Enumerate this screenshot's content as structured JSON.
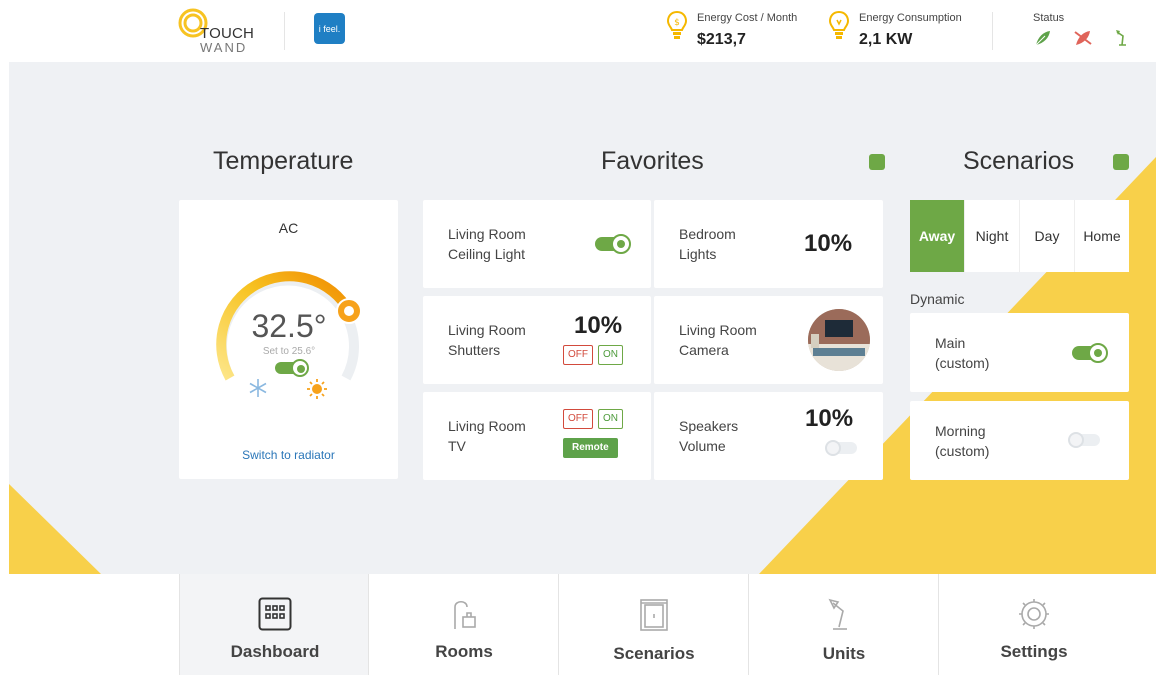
{
  "header": {
    "logo_line1": "TOUCH",
    "logo_line2": "WAND",
    "partner_logo": "i feel.",
    "energy_cost_label": "Energy Cost / Month",
    "energy_cost_value": "$213,7",
    "energy_consumption_label": "Energy Consumption",
    "energy_consumption_value": "2,1 KW",
    "status_label": "Status",
    "status_icons": [
      "leaf-icon",
      "leaf-crossed-icon",
      "lamp-icon"
    ]
  },
  "temperature": {
    "title": "Temperature",
    "mode": "AC",
    "value": "32.5°",
    "set_to": "Set to 25.6°",
    "switch_link": "Switch to radiator",
    "ac_on": true
  },
  "favorites": {
    "title": "Favorites",
    "items": [
      {
        "name_line1": "Living Room",
        "name_line2": "Ceiling Light",
        "control": "toggle",
        "on": true
      },
      {
        "name_line1": "Bedroom",
        "name_line2": "Lights",
        "value": "10%"
      },
      {
        "name_line1": "Living Room",
        "name_line2": "Shutters",
        "value": "10%",
        "off_label": "OFF",
        "on_label": "ON"
      },
      {
        "name_line1": "Living Room",
        "name_line2": "Camera",
        "control": "camera"
      },
      {
        "name_line1": "Living Room",
        "name_line2": "TV",
        "off_label": "OFF",
        "on_label": "ON",
        "remote_label": "Remote"
      },
      {
        "name_line1": "Speakers",
        "name_line2": "Volume",
        "value": "10%",
        "on": false
      }
    ]
  },
  "scenarios": {
    "title": "Scenarios",
    "tabs": [
      "Away",
      "Night",
      "Day",
      "Home"
    ],
    "active_tab": "Away",
    "dynamic_label": "Dynamic",
    "items": [
      {
        "name_line1": "Main",
        "name_line2": "(custom)",
        "on": true
      },
      {
        "name_line1": "Morning",
        "name_line2": "(custom)",
        "on": false
      }
    ]
  },
  "nav": {
    "items": [
      "Dashboard",
      "Rooms",
      "Scenarios",
      "Units",
      "Settings"
    ],
    "active": "Dashboard"
  },
  "colors": {
    "accent_green": "#6ea846",
    "accent_yellow": "#f8d04a",
    "link_blue": "#2a76b8",
    "off_red": "#d24a3c"
  }
}
